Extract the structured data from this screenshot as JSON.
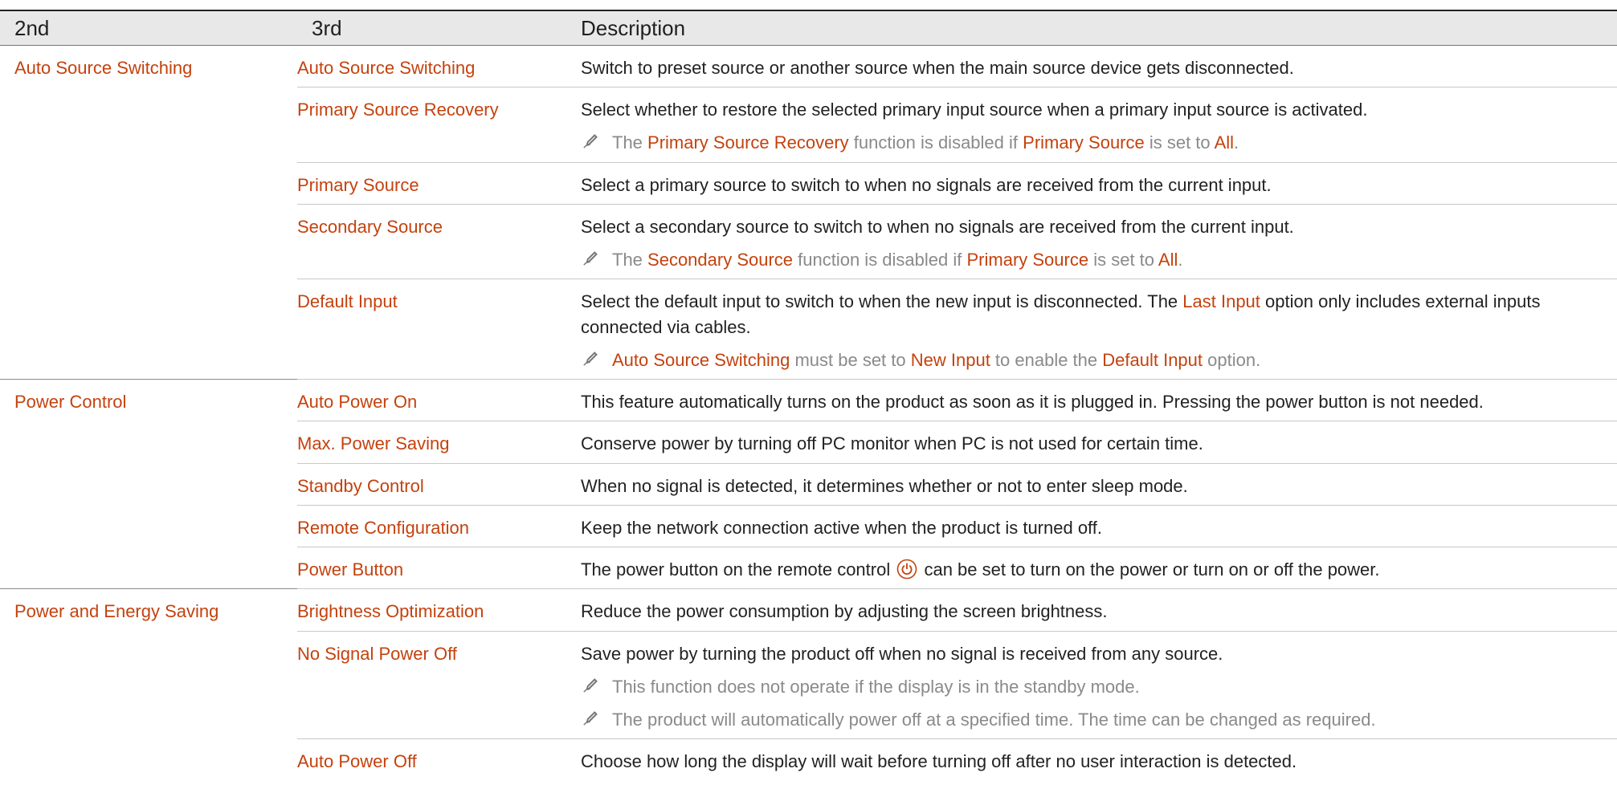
{
  "columns": {
    "c1": "2nd",
    "c2": "3rd",
    "c3": "Description"
  },
  "icons": {
    "note": "pencil-note-icon",
    "power": "power-button-icon"
  },
  "colors": {
    "highlight": "#c4420e",
    "note_text": "#8a8a8a",
    "header_bg": "#e8e8e8"
  },
  "groups": {
    "auto_source": {
      "name": "Auto Source Switching",
      "rows": {
        "r1": {
          "name": "Auto Source Switching",
          "desc": "Switch to preset source or another source when the main source device gets disconnected."
        },
        "r2": {
          "name": "Primary Source Recovery",
          "desc": "Select whether to restore the selected primary input source when a primary input source is activated.",
          "note": {
            "t1": "The ",
            "h1": "Primary Source Recovery",
            "t2": " function is disabled if ",
            "h2": "Primary Source",
            "t3": " is set to ",
            "h3": "All",
            "t4": "."
          }
        },
        "r3": {
          "name": "Primary Source",
          "desc": "Select a primary source to switch to when no signals are received from the current input."
        },
        "r4": {
          "name": "Secondary Source",
          "desc": "Select a secondary source to switch to when no signals are received from the current input.",
          "note": {
            "t1": "The ",
            "h1": "Secondary Source",
            "t2": " function is disabled if ",
            "h2": "Primary Source",
            "t3": " is set to ",
            "h3": "All",
            "t4": "."
          }
        },
        "r5": {
          "name": "Default Input",
          "desc": {
            "t1": "Select the default input to switch to when the new input is disconnected. The ",
            "h1": "Last Input",
            "t2": " option only includes external inputs connected via cables."
          },
          "note": {
            "h1": "Auto Source Switching",
            "t1": " must be set to ",
            "h2": "New Input",
            "t2": " to enable the ",
            "h3": "Default Input",
            "t3": " option."
          }
        }
      }
    },
    "power_control": {
      "name": "Power Control",
      "rows": {
        "r1": {
          "name": "Auto Power On",
          "desc": "This feature automatically turns on the product as soon as it is plugged in. Pressing the power button is not needed."
        },
        "r2": {
          "name": "Max. Power Saving",
          "desc": "Conserve power by turning off PC monitor when PC is not used for certain time."
        },
        "r3": {
          "name": "Standby Control",
          "desc": "When no signal is detected, it determines whether or not to enter sleep mode."
        },
        "r4": {
          "name": "Remote Configuration",
          "desc": "Keep the network connection active when the product is turned off."
        },
        "r5": {
          "name": "Power Button",
          "desc": {
            "t1": "The power button on the remote control ",
            "t2": " can be set to turn on the power or turn on or off the power."
          }
        }
      }
    },
    "power_energy": {
      "name": "Power and Energy Saving",
      "rows": {
        "r1": {
          "name": "Brightness Optimization",
          "desc": "Reduce the power consumption by adjusting the screen brightness."
        },
        "r2": {
          "name": "No Signal Power Off",
          "desc": "Save power by turning the product off when no signal is received from any source.",
          "note1": "This function does not operate if the display is in the standby mode.",
          "note2": "The product will automatically power off at a specified time. The time can be changed as required."
        },
        "r3": {
          "name": "Auto Power Off",
          "desc": "Choose how long the display will wait before turning off after no user interaction is detected."
        }
      }
    }
  }
}
